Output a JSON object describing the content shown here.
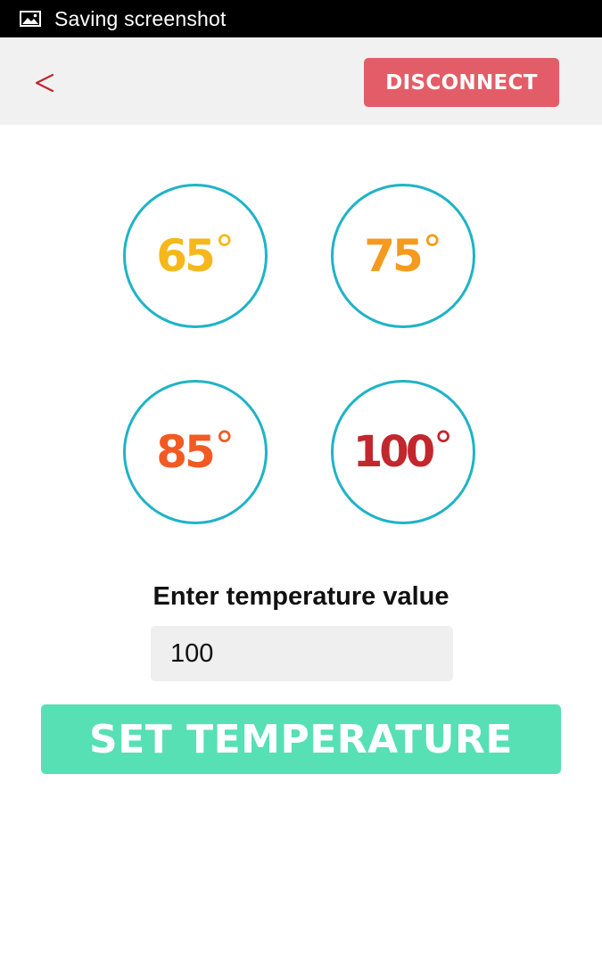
{
  "status_bar": {
    "icon": "image-icon",
    "text": "Saving screenshot"
  },
  "toolbar": {
    "back_icon": "chevron-left-icon",
    "disconnect_label": "DISCONNECT",
    "colors": {
      "background": "#f1f1f1",
      "back": "#c1272d",
      "disconnect": "#e35d68"
    }
  },
  "presets": [
    {
      "value": "65",
      "unit": "°",
      "color": "#f5b81c"
    },
    {
      "value": "75",
      "unit": "°",
      "color": "#f49a1c"
    },
    {
      "value": "85",
      "unit": "°",
      "color": "#f15a24"
    },
    {
      "value": "100",
      "unit": "°",
      "color": "#c1272d"
    }
  ],
  "circle_border_color": "#1fb3c7",
  "form": {
    "label": "Enter temperature value",
    "input_value": "100",
    "submit_label": "SET TEMPERATURE",
    "submit_color": "#56e0b4"
  }
}
